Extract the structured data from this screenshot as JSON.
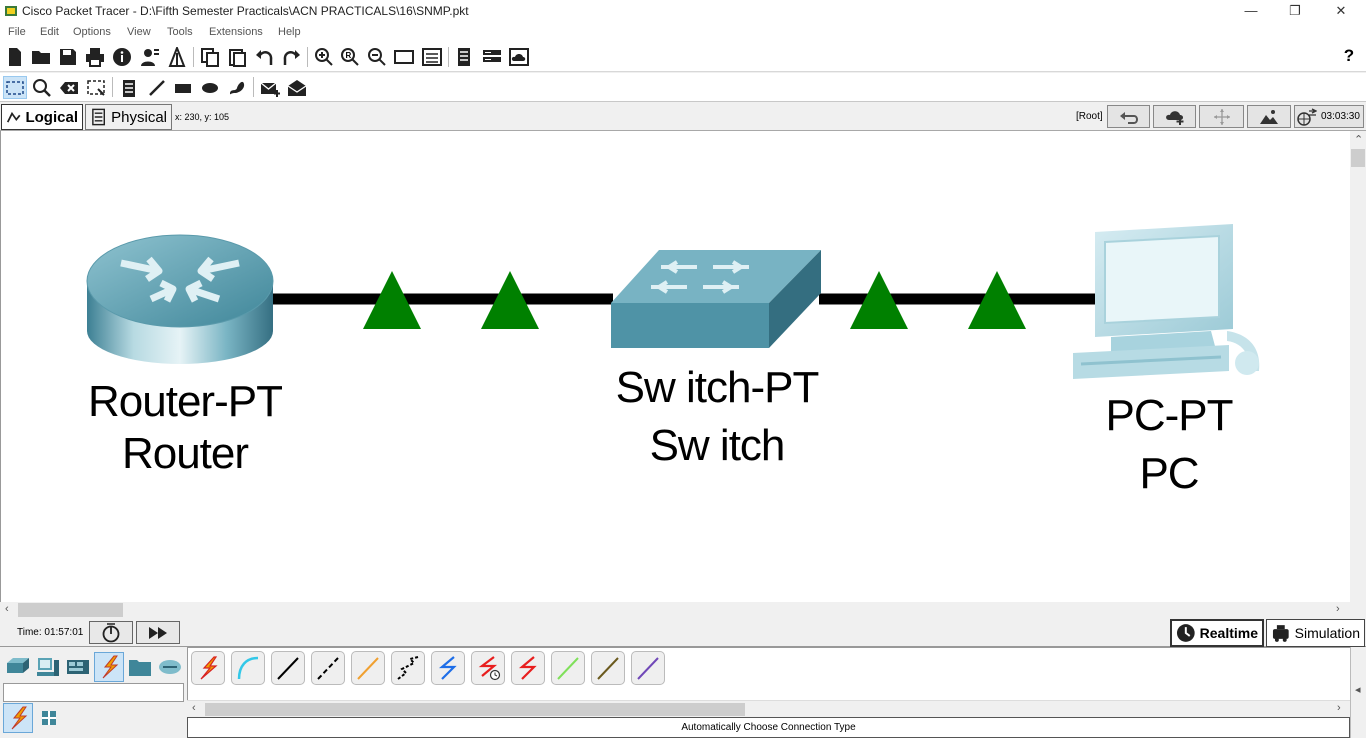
{
  "window": {
    "title": "Cisco Packet Tracer - D:\\Fifth Semester Practicals\\ACN PRACTICALS\\16\\SNMP.pkt",
    "minimize": "—",
    "restore": "❐",
    "close": "✕"
  },
  "menu": [
    "File",
    "Edit",
    "Options",
    "View",
    "Tools",
    "Extensions",
    "Help"
  ],
  "toolbar": {
    "help_label": "?"
  },
  "workspace": {
    "tabs": [
      {
        "label": "Logical",
        "active": true
      },
      {
        "label": "Physical",
        "active": false
      }
    ],
    "coords": "x: 230, y: 105",
    "root_label": "[Root]",
    "clock": "03:03:30"
  },
  "topology": {
    "devices": [
      {
        "model": "Router-PT",
        "name": "Router",
        "icon": "router-icon"
      },
      {
        "model": "Sw itch-PT",
        "name": "Sw itch",
        "icon": "switch-icon"
      },
      {
        "model": "PC-PT",
        "name": "PC",
        "icon": "pc-icon"
      }
    ],
    "link_color": "#000000",
    "link_status_color": "#008000"
  },
  "timebar": {
    "time": "Time: 01:57:01",
    "modes": [
      {
        "label": "Realtime",
        "active": true
      },
      {
        "label": "Simulation",
        "active": false
      }
    ]
  },
  "devices_panel": {
    "category_name": ""
  },
  "connections_panel": {
    "status": "Automatically Choose Connection Type",
    "types": [
      {
        "icon": "automatic-connection-icon",
        "color": "#f0a000"
      },
      {
        "icon": "console-connection-icon",
        "color": "#33c8e8"
      },
      {
        "icon": "copper-straight-through-icon",
        "color": "#000000"
      },
      {
        "icon": "copper-cross-over-icon",
        "color": "#000000"
      },
      {
        "icon": "fiber-icon",
        "color": "#f0a030"
      },
      {
        "icon": "phone-connection-icon",
        "color": "#000000"
      },
      {
        "icon": "coaxial-icon",
        "color": "#1e6ee8"
      },
      {
        "icon": "serial-dce-icon",
        "color": "#e81e1e"
      },
      {
        "icon": "serial-dte-icon",
        "color": "#e81e1e"
      },
      {
        "icon": "octal-icon",
        "color": "#7fe05a"
      },
      {
        "icon": "iot-custom-cable-icon",
        "color": "#6b5a1e"
      },
      {
        "icon": "usb-icon",
        "color": "#7048b8"
      }
    ]
  }
}
